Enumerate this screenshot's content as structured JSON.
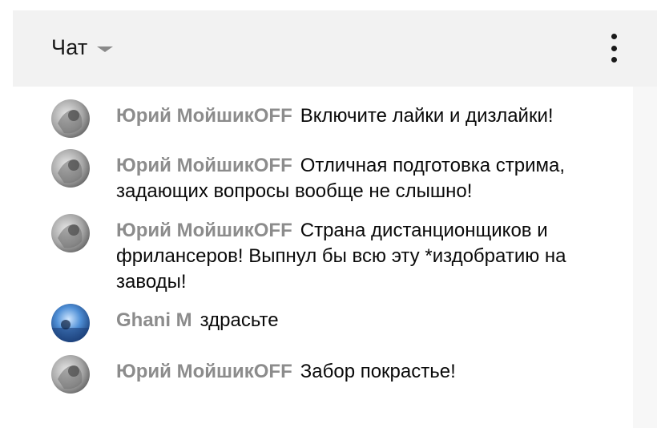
{
  "header": {
    "title": "Чат",
    "dropdown_icon": "chevron-down-icon",
    "menu_icon": "more-vert-icon"
  },
  "messages": [
    {
      "author": "Юрий МойшикOFF",
      "text": "Включите лайки и дизлайки!",
      "avatar": "grayscale-photo"
    },
    {
      "author": "Юрий МойшикOFF",
      "text": "Отличная подготовка стрима, задающих вопросы вообще не слышно!",
      "avatar": "grayscale-photo"
    },
    {
      "author": "Юрий МойшикOFF",
      "text": "Страна дистанционщиков и фрилансеров! Выпнул бы всю эту *издобратию на заводы!",
      "avatar": "grayscale-photo"
    },
    {
      "author": "Ghani M",
      "text": "здрасьте",
      "avatar": "blue-photo"
    },
    {
      "author": "Юрий МойшикOFF",
      "text": "Забор покрастье!",
      "avatar": "grayscale-photo"
    }
  ],
  "colors": {
    "header_bg": "#f2f2f2",
    "author": "#8c8c8c",
    "text": "#0a0a0a"
  }
}
